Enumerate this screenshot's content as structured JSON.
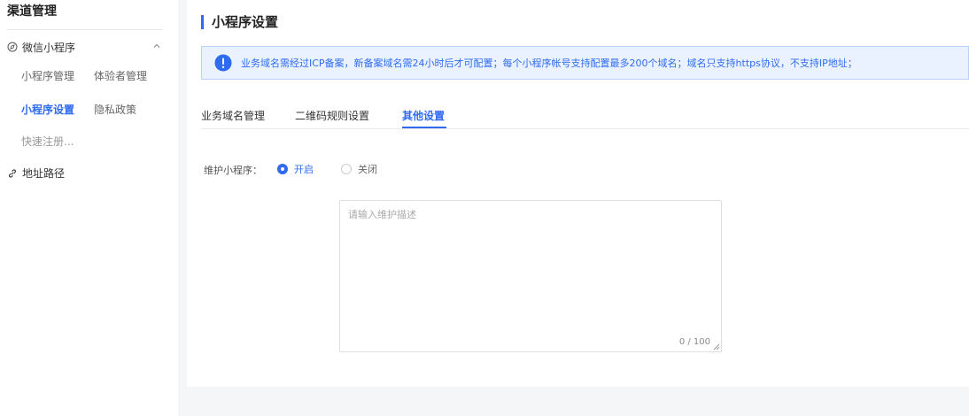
{
  "sidebar": {
    "title": "渠道管理",
    "group_label": "微信小程序",
    "row1": [
      "小程序管理",
      "体验者管理"
    ],
    "row2": [
      "小程序设置",
      "隐私政策"
    ],
    "row3": [
      "快速注册..."
    ],
    "address_label": "地址路径",
    "active_item": "小程序设置"
  },
  "main": {
    "title": "小程序设置",
    "alert_text": "业务域名需经过ICP备案，新备案域名需24小时后才可配置；每个小程序帐号支持配置最多200个域名；域名只支持https协议，不支持IP地址；",
    "tabs": [
      "业务域名管理",
      "二维码规则设置",
      "其他设置"
    ],
    "active_tab": "其他设置",
    "form": {
      "label": "维护小程序：",
      "option_on": "开启",
      "option_off": "关闭",
      "selected": "开启",
      "textarea_placeholder": "请输入维护描述",
      "textarea_value": "",
      "counter": "0 / 100"
    }
  },
  "colors": {
    "accent": "#2f6bef",
    "alert_bg": "#eaf2ff",
    "page_bg": "#f5f6f8"
  }
}
